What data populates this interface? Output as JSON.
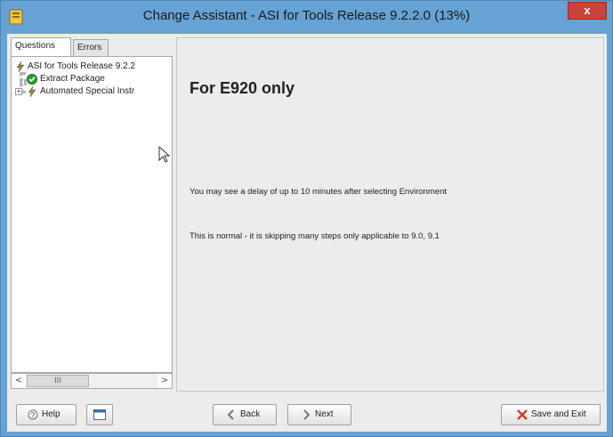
{
  "window": {
    "title": "Change Assistant - ASI for Tools Release 9.2.2.0 (13%)",
    "close_label": "x"
  },
  "tabs": [
    {
      "label": "Questions",
      "active": true
    },
    {
      "label": "Errors",
      "active": false
    }
  ],
  "tree": {
    "root": "ASI for Tools Release 9.2.2",
    "children": [
      {
        "label": "Extract Package",
        "icon": "check-circle-icon"
      },
      {
        "label": "Automated Special Instr",
        "icon": "lightning-icon"
      }
    ],
    "scroll_grip": "III"
  },
  "content": {
    "heading": "For E920 only",
    "messages": [
      "You may see a delay of up to 10 minutes after selecting Environment",
      "This is normal - it is skipping many steps only applicable to 9.0, 9.1"
    ]
  },
  "buttons": {
    "help": "Help",
    "back": "Back",
    "next": "Next",
    "save_exit": "Save and Exit"
  },
  "colors": {
    "titlebar": "#66a2d4",
    "close": "#c9433a",
    "success": "#2e9e2e"
  }
}
